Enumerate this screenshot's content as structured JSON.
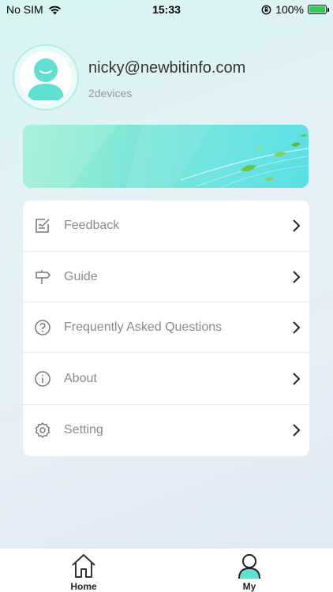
{
  "status_bar": {
    "carrier": "No SIM",
    "time": "15:33",
    "battery": "100%",
    "battery_level": 1.0
  },
  "profile": {
    "email": "nicky@newbitinfo.com",
    "devices": "2devices"
  },
  "menu": {
    "items": [
      {
        "label": "Feedback",
        "icon": "feedback-icon"
      },
      {
        "label": "Guide",
        "icon": "signpost-icon"
      },
      {
        "label": "Frequently Asked Questions",
        "icon": "question-icon"
      },
      {
        "label": "About",
        "icon": "info-icon"
      },
      {
        "label": "Setting",
        "icon": "gear-icon"
      }
    ]
  },
  "tab_bar": {
    "tabs": [
      {
        "label": "Home",
        "icon": "home-icon",
        "active": false
      },
      {
        "label": "My",
        "icon": "person-icon",
        "active": true
      }
    ]
  },
  "colors": {
    "accent": "#3ee0d0",
    "text_secondary": "#8a8a8a",
    "banner_start": "#a0efd6",
    "banner_end": "#59dfe6"
  }
}
